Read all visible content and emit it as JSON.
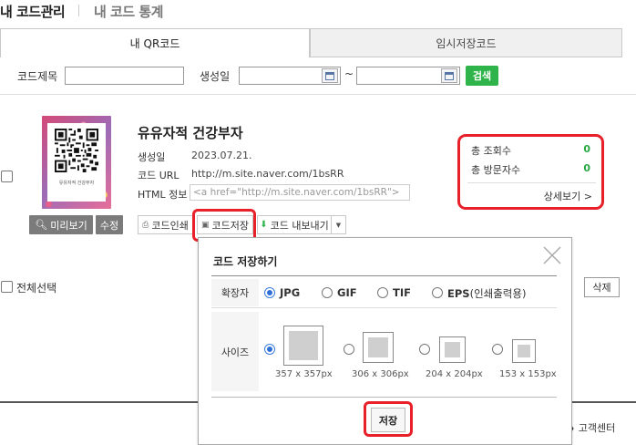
{
  "header": {
    "title": "내 코드관리",
    "subtitle": "내 코드 통계"
  },
  "tabs": [
    {
      "label": "내 QR코드",
      "active": true
    },
    {
      "label": "임시저장코드",
      "active": false
    }
  ],
  "search": {
    "code_title_label": "코드제목",
    "code_title_value": "",
    "created_label": "생성일",
    "range_sep": "~",
    "search_button": "검색"
  },
  "card": {
    "qr_caption": "유유자적 건강부자",
    "preview_button": "미리보기",
    "edit_button": "수정",
    "title": "유유자적 건강부자",
    "created_label": "생성일",
    "created_value": "2023.07.21.",
    "url_label": "코드 URL",
    "url_value": "http://m.site.naver.com/1bsRR",
    "html_label": "HTML 정보",
    "html_value": "<a href=\"http://m.site.naver.com/1bsRR\">",
    "print_button": "코드인쇄",
    "save_button": "코드저장",
    "export_button": "코드 내보내기",
    "stats": {
      "total_views_label": "총 조회수",
      "total_views_value": "0",
      "total_visitors_label": "총 방문자수",
      "total_visitors_value": "0",
      "detail_link": "상세보기 >"
    }
  },
  "popup": {
    "title": "코드 저장하기",
    "ext_label": "확장자",
    "formats": [
      {
        "name": "JPG",
        "note": "",
        "selected": true
      },
      {
        "name": "GIF",
        "note": "",
        "selected": false
      },
      {
        "name": "TIF",
        "note": "",
        "selected": false
      },
      {
        "name": "EPS",
        "note": "(인쇄출력용)",
        "selected": false
      }
    ],
    "size_label": "사이즈",
    "sizes": [
      {
        "label": "357 x 357px",
        "selected": true
      },
      {
        "label": "306 x 306px",
        "selected": false
      },
      {
        "label": "204 x 204px",
        "selected": false
      },
      {
        "label": "153 x 153px",
        "selected": false
      }
    ],
    "save_button": "저장"
  },
  "select_all_label": "전체선택",
  "delete_button": "삭제",
  "footer": {
    "customer_center": "고객센터"
  },
  "colors": {
    "accent_green": "#2eb44a",
    "highlight_red": "#e8202a",
    "count_green": "#28a745"
  }
}
